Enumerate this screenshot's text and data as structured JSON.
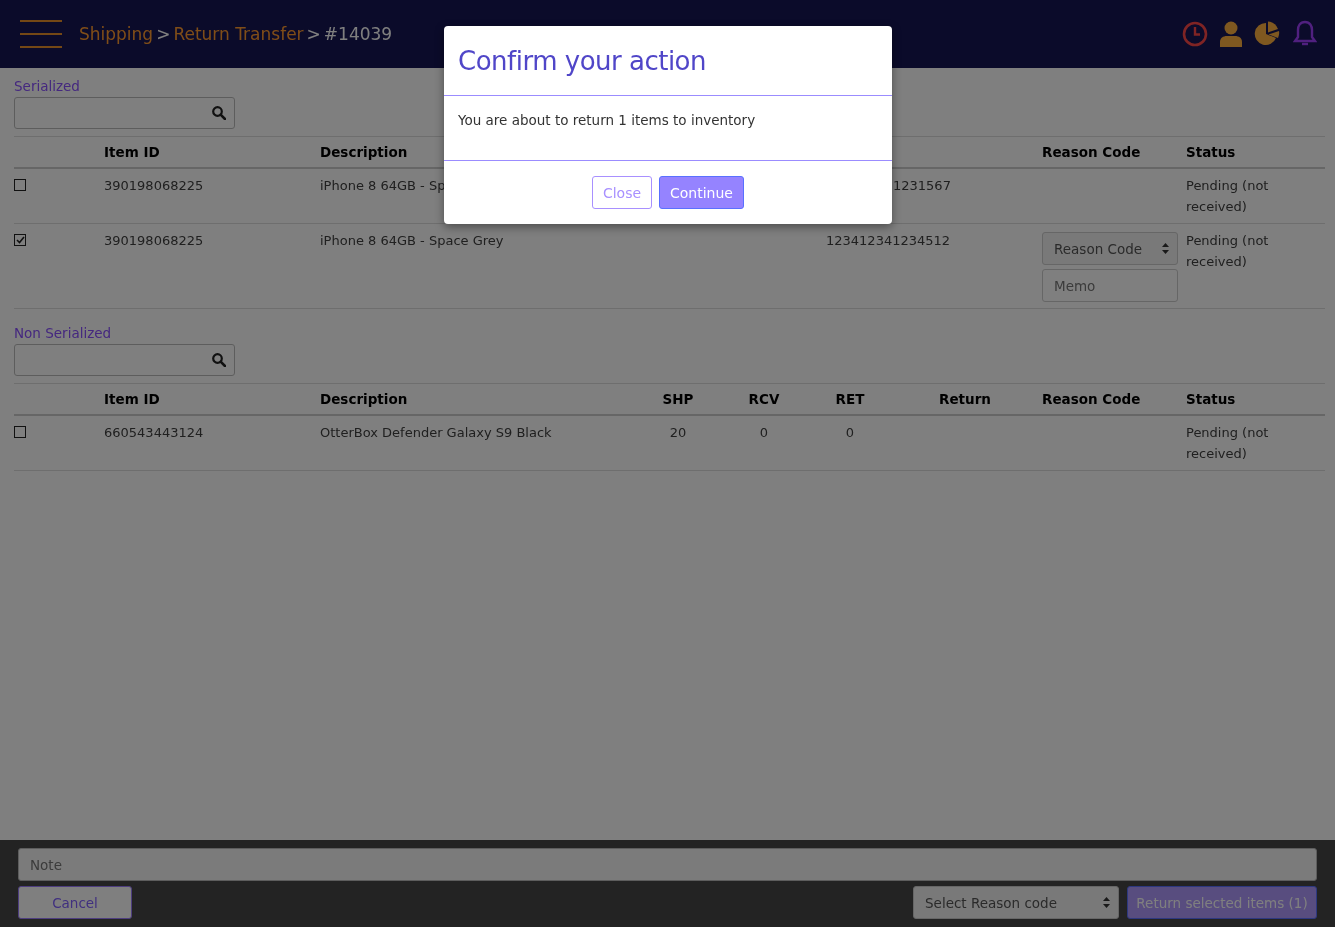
{
  "header": {
    "breadcrumb": [
      {
        "kind": "link",
        "text": "Shipping"
      },
      {
        "kind": "separator",
        "text": ">"
      },
      {
        "kind": "link",
        "text": "Return Transfer"
      },
      {
        "kind": "separator",
        "text": ">"
      },
      {
        "kind": "current",
        "text": "#14039"
      }
    ]
  },
  "sections": [
    {
      "title": "Serialized",
      "columns": [
        {
          "kind": "text",
          "label": "Item ID"
        },
        {
          "kind": "text",
          "label": "Description"
        },
        {
          "kind": "text"
        },
        {
          "kind": "reason",
          "label": "Reason Code"
        },
        {
          "kind": "status",
          "label": "Status"
        }
      ],
      "rows": [
        {
          "checked": false,
          "cells": [
            "390198068225",
            "iPhone 8 64GB - Sp",
            {
              "kind": "partly_hidden",
              "text": "1231567"
            },
            null,
            "Pending (not received)"
          ]
        },
        {
          "checked": true,
          "cells": [
            "390198068225",
            "iPhone 8 64GB - Space Grey",
            "123412341234512",
            null,
            "Pending (not received)"
          ],
          "reason_select": {
            "placeholder": "Reason Code"
          },
          "memo": {
            "placeholder": "Memo"
          }
        }
      ]
    },
    {
      "title": "Non Serialized",
      "columns": [
        {
          "kind": "text",
          "label": "Item ID"
        },
        {
          "kind": "text",
          "label": "Description"
        },
        {
          "kind": "number",
          "label": "SHP"
        },
        {
          "kind": "number",
          "label": "RCV"
        },
        {
          "kind": "number",
          "label": "RET"
        },
        {
          "kind": "number",
          "label": "Return"
        },
        {
          "kind": "reason",
          "label": "Reason Code"
        },
        {
          "kind": "status",
          "label": "Status"
        }
      ],
      "rows": [
        {
          "checked": false,
          "cells": [
            "660543443124",
            "OtterBox Defender Galaxy S9 Black",
            "20",
            "0",
            "0",
            null,
            null,
            "Pending (not received)"
          ]
        }
      ]
    }
  ],
  "footer": {
    "note": {
      "placeholder": "Note"
    },
    "cancel": "Cancel",
    "reason_select": {
      "placeholder": "Select Reason code"
    },
    "submit": "Return selected items (1)"
  },
  "modal": {
    "title": "Confirm your action",
    "message": "You are about to return 1 items to inventory",
    "buttons": [
      {
        "kind": "secondary",
        "label": "Close"
      },
      {
        "kind": "primary",
        "label": "Continue"
      }
    ]
  }
}
